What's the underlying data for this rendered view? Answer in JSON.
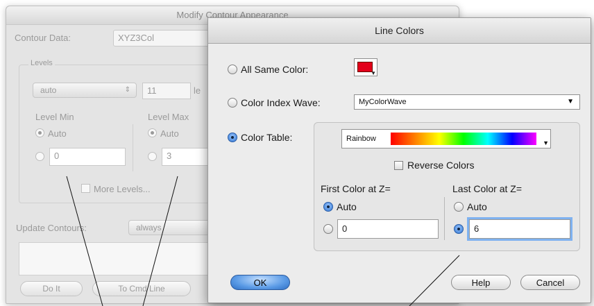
{
  "back_dialog": {
    "title": "Modify Contour Appearance",
    "contour_data_label": "Contour Data:",
    "contour_data_value": "XYZ3Col",
    "levels_group_label": "Levels",
    "levels_mode_value": "auto",
    "levels_count_value": "11",
    "levels_count_suffix": "le",
    "level_min_label": "Level Min",
    "level_max_label": "Level Max",
    "auto_label": "Auto",
    "level_min_value": "0",
    "level_max_value": "3",
    "more_levels_label": "More Levels...",
    "update_contours_label": "Update Contours:",
    "update_contours_value": "always",
    "do_it_label": "Do It",
    "to_cmd_line_label": "To Cmd Line"
  },
  "line_colors_dialog": {
    "title": "Line Colors",
    "all_same_color_label": "All Same Color:",
    "all_same_color_swatch": "#e3001b",
    "color_index_wave_label": "Color Index Wave:",
    "color_index_wave_value": "MyColorWave",
    "color_table_label": "Color Table:",
    "color_table_value": "Rainbow",
    "reverse_colors_label": "Reverse Colors",
    "first_color_label": "First Color at Z=",
    "last_color_label": "Last Color at Z=",
    "auto_label": "Auto",
    "first_color_value": "0",
    "last_color_value": "6",
    "ok_label": "OK",
    "help_label": "Help",
    "cancel_label": "Cancel",
    "selected_option": "Color Table"
  },
  "icons": {
    "popup_arrow": "chevron-down-icon",
    "stepper": "stepper-icon"
  }
}
